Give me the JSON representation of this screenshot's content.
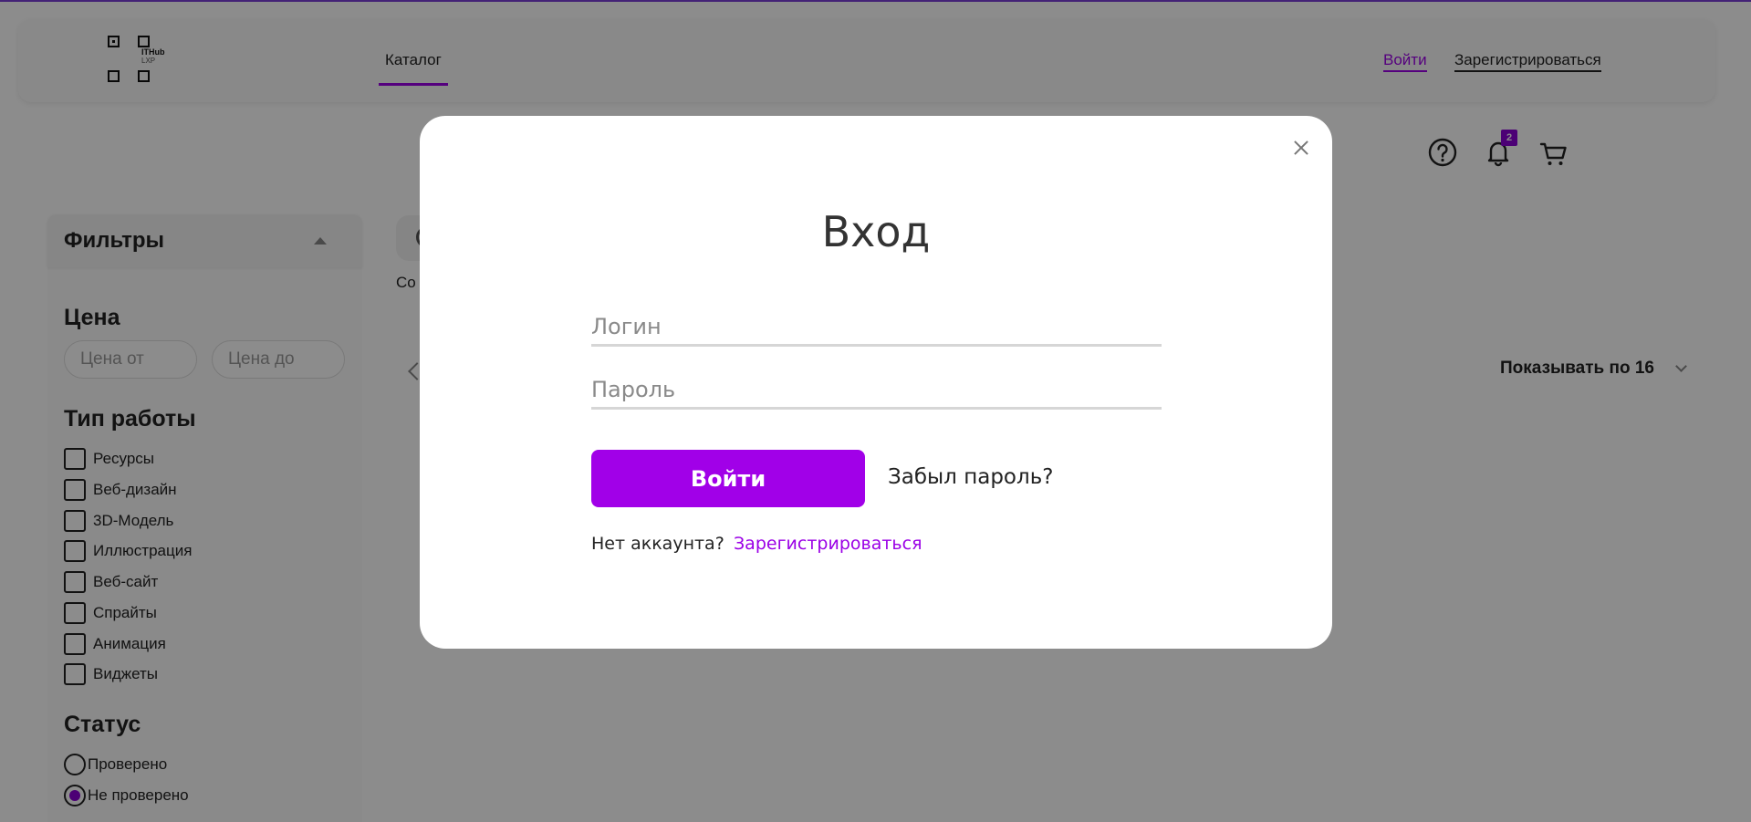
{
  "header": {
    "logo_line1": "ITHub",
    "logo_line2": "LXP",
    "nav_catalog": "Каталог",
    "login_link": "Войти",
    "register_link": "Зарегистрироваться"
  },
  "icons": {
    "help": "help-icon",
    "notifications": "bell-icon",
    "notifications_badge": "2",
    "cart": "cart-icon"
  },
  "sidebar": {
    "title": "Фильтры",
    "price_title": "Цена",
    "price_from_placeholder": "Цена от",
    "price_to_placeholder": "Цена до",
    "work_type_title": "Тип работы",
    "work_types": [
      "Ресурсы",
      "Веб-дизайн",
      "3D-Модель",
      "Иллюстрация",
      "Веб-сайт",
      "Спрайты",
      "Анимация",
      "Виджеты"
    ],
    "status_title": "Статус",
    "status_options": [
      {
        "label": "Проверено",
        "selected": false
      },
      {
        "label": "Не проверено",
        "selected": true
      }
    ]
  },
  "main": {
    "sort_partial": "Со",
    "show_per_page": "Показывать по 16"
  },
  "modal": {
    "title": "Вход",
    "login_placeholder": "Логин",
    "password_placeholder": "Пароль",
    "submit_label": "Войти",
    "forgot_label": "Забыл пароль?",
    "no_account_label": "Нет аккаунта?",
    "register_label": "Зарегистрироваться"
  },
  "colors": {
    "accent": "#9b00e6",
    "button": "#a100e8",
    "overlay": "rgba(0,0,0,0.45)"
  }
}
